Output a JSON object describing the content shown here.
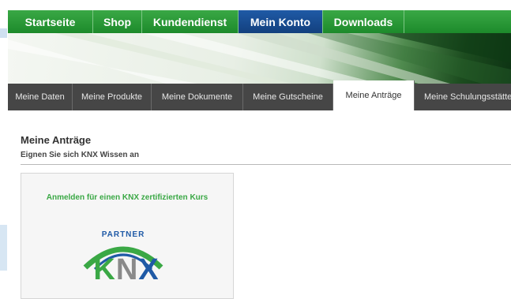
{
  "topnav": {
    "items": [
      {
        "label": "Startseite",
        "active": false
      },
      {
        "label": "Shop",
        "active": false
      },
      {
        "label": "Kundendienst",
        "active": false
      },
      {
        "label": "Mein Konto",
        "active": true
      },
      {
        "label": "Downloads",
        "active": false
      }
    ]
  },
  "subtabs": {
    "items": [
      {
        "label": "Meine Daten",
        "active": false
      },
      {
        "label": "Meine Produkte",
        "active": false
      },
      {
        "label": "Meine Dokumente",
        "active": false
      },
      {
        "label": "Meine Gutscheine",
        "active": false
      },
      {
        "label": "Meine Anträge",
        "active": true
      },
      {
        "label": "Meine Schulungsstätte",
        "active": false
      }
    ]
  },
  "main": {
    "title": "Meine Anträge",
    "subtitle": "Eignen Sie sich KNX Wissen an"
  },
  "card": {
    "link_text": "Anmelden für einen KNX zertifizierten Kurs",
    "logo": {
      "icon": "knx-partner-logo",
      "partner_text": "PARTNER",
      "knx_k": "K",
      "knx_n": "N",
      "knx_x": "X"
    }
  },
  "colors": {
    "nav_green": "#2a9a38",
    "nav_active_blue": "#1a4f94",
    "subtab_dark": "#464646",
    "link_green": "#3aa845",
    "knx_blue": "#1f5aa6",
    "knx_grey": "#8a8a8a"
  }
}
